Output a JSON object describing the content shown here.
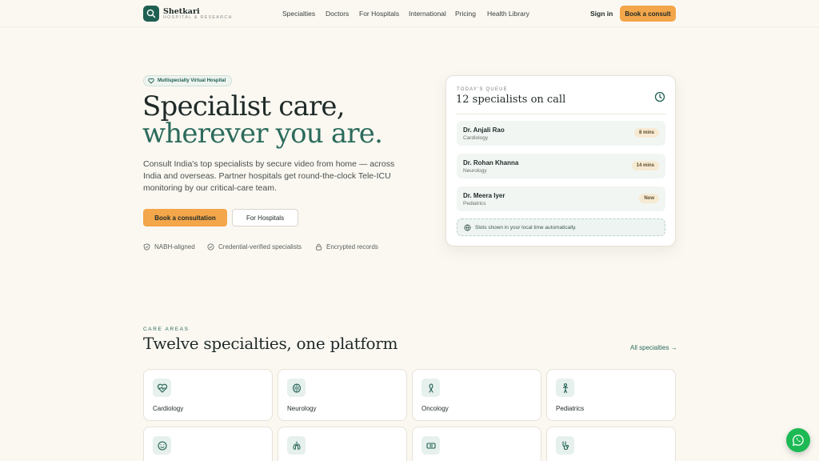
{
  "nav": {
    "brand_name": "Shetkari",
    "brand_sub": "HOSPITAL & RESEARCH",
    "links": [
      "Specialties",
      "Doctors",
      "For Hospitals",
      "International",
      "Pricing",
      "Health Library"
    ],
    "signin": "Sign in",
    "cta": "Book a consult"
  },
  "hero": {
    "badge": "Multispecialty Virtual Hospital",
    "title_line1": "Specialist care,",
    "title_line2": "wherever you are.",
    "lead": "Consult India's top specialists by secure video from home — across India and overseas. Partner hospitals get round-the-clock Tele-ICU monitoring by our critical-care team.",
    "primary_btn": "Book a consultation",
    "secondary_btn": "For Hospitals",
    "trust": [
      "NABH-aligned",
      "Credential-verified specialists",
      "Encrypted records"
    ]
  },
  "queue": {
    "label": "TODAY'S QUEUE",
    "title": "12 specialists on call",
    "rows": [
      {
        "name": "Dr. Anjali Rao",
        "dept": "Cardiology",
        "wait": "8 mins"
      },
      {
        "name": "Dr. Rohan Khanna",
        "dept": "Neurology",
        "wait": "14 mins"
      },
      {
        "name": "Dr. Meera Iyer",
        "dept": "Pediatrics",
        "wait": "Now"
      }
    ],
    "note": "Slots shown in your local time automatically."
  },
  "care": {
    "eyebrow": "CARE AREAS",
    "title": "Twelve specialties, one platform",
    "all_link": "All specialties →",
    "specialties": [
      "Cardiology",
      "Neurology",
      "Oncology",
      "Pediatrics"
    ]
  },
  "colors": {
    "brand": "#1f5f52",
    "accent": "#f3a64a",
    "background": "#fbf8f2"
  }
}
